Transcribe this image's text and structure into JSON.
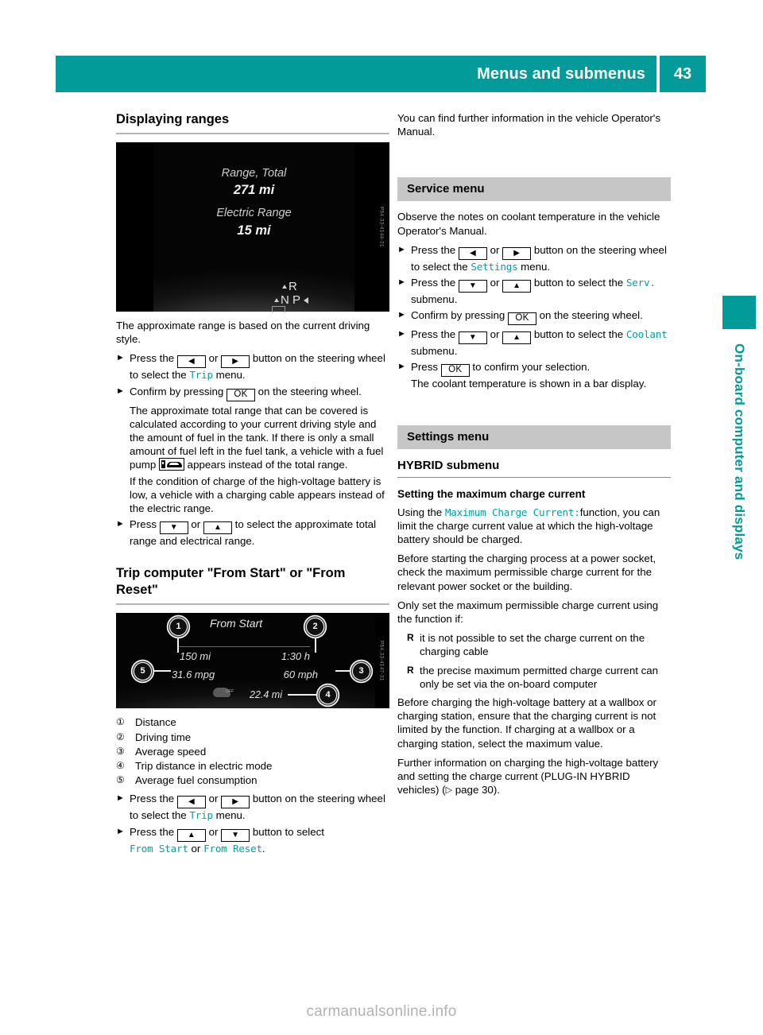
{
  "header": {
    "title": "Menus and submenus",
    "page_number": "43"
  },
  "side_tab": {
    "label": "On-board computer and displays"
  },
  "footer": {
    "watermark": "carmanualsonline.info"
  },
  "left_column": {
    "section_title": "Displaying ranges",
    "figure_range": {
      "label_total": "Range, Total",
      "value_total": "271 mi",
      "label_electric": "Electric Range",
      "value_electric": "15 mi",
      "gear_r": "R",
      "gear_n": "N",
      "gear_p": "P",
      "code": "P54.33-4144-31"
    },
    "intro": "The approximate range is based on the current driving style.",
    "step1_a": "Press the",
    "step1_or": "or",
    "step1_b": "button on the steering",
    "step1_c": "wheel to select the",
    "step1_menu": "Trip",
    "step1_d": "menu.",
    "step2_a": "Confirm by pressing",
    "step2_ok": "OK",
    "step2_b": "on the steering",
    "step2_c": "wheel.",
    "step2_note1": "The approximate total range that can be covered is calculated according to your current driving style and the amount of fuel in the tank. If there is only a small amount of fuel left in the fuel tank, a vehicle with a fuel pump",
    "step2_note1_end": "appears instead of the total range.",
    "step2_note2": "If the condition of charge of the high-voltage battery is low, a vehicle with a charging cable appears instead of the electric range.",
    "step3_a": "Press",
    "step3_or": "or",
    "step3_b": "to select the approximate total range and electrical range.",
    "trip_title": "Trip computer \"From Start\" or \"From Reset\"",
    "figure_trip": {
      "title": "From Start",
      "value_1": "150 mi",
      "value_2": "1:30 h",
      "value_5": "31.6 mpg",
      "value_3": "60 mph",
      "value_4": "22.4 mi",
      "callout_1": "1",
      "callout_2": "2",
      "callout_3": "3",
      "callout_4": "4",
      "callout_5": "5",
      "code": "P54.33-4147-31"
    },
    "legend": [
      {
        "num": "①",
        "text": "Distance"
      },
      {
        "num": "②",
        "text": "Driving time"
      },
      {
        "num": "③",
        "text": "Average speed"
      },
      {
        "num": "④",
        "text": "Trip distance in electric mode"
      },
      {
        "num": "⑤",
        "text": "Average fuel consumption"
      }
    ],
    "step4_a": "Press the",
    "step4_or": "or",
    "step4_b": "button on the steering",
    "step4_c": "wheel to select the",
    "step4_menu": "Trip",
    "step4_d": "menu.",
    "step5_a": "Press the",
    "step5_or": "or",
    "step5_b": "button to select",
    "step5_opt1": "From Start",
    "step5_mid": "or",
    "step5_opt2": "From Reset",
    "step5_end": "."
  },
  "right_column": {
    "intro": "You can find further information in the vehicle Operator's Manual.",
    "service_heading": "Service menu",
    "service_intro": "Observe the notes on coolant temperature in the vehicle Operator's Manual.",
    "s1_a": "Press the",
    "s1_or": "or",
    "s1_b": "button on the steering",
    "s1_c": "wheel to select the",
    "s1_menu": "Settings",
    "s1_d": "menu.",
    "s2_a": "Press the",
    "s2_or": "or",
    "s2_b": "button to select the",
    "s2_menu": "Serv.",
    "s2_c": "submenu.",
    "s3_a": "Confirm by pressing",
    "s3_ok": "OK",
    "s3_b": "on the steering",
    "s3_c": "wheel.",
    "s4_a": "Press the",
    "s4_or": "or",
    "s4_b": "button to select the",
    "s4_menu": "Coolant",
    "s4_c": "submenu.",
    "s5_a": "Press",
    "s5_ok": "OK",
    "s5_b": "to confirm your selection.",
    "s5_note": "The coolant temperature is shown in a bar display.",
    "settings_heading": "Settings menu",
    "hybrid_heading": "HYBRID submenu",
    "charge_heading": "Setting the maximum charge current",
    "charge_p1_a": "Using the",
    "charge_p1_mono": "Maximum Charge Current:",
    "charge_p1_b": "function, you can limit the charge current value at which the high-voltage battery should be charged.",
    "charge_p2": "Before starting the charging process at a power socket, check the maximum permissible charge current for the relevant power socket or the building.",
    "charge_p3": "Only set the maximum permissible charge current using the function if:",
    "bullets": [
      "it is not possible to set the charge current on the charging cable",
      "the precise maximum permitted charge current can only be set via the on-board computer"
    ],
    "charge_p4": "Before charging the high-voltage battery at a wallbox or charging station, ensure that the charging current is not limited by the function. If charging at a wallbox or a charging station, select the maximum value.",
    "charge_p5_a": "Further information on charging the high-voltage battery and setting the charge current (PLUG-IN HYBRID vehicles) (",
    "charge_p5_ref": "page 30",
    "charge_p5_b": ")."
  },
  "colors": {
    "teal": "#039a9a",
    "mono_teal": "#00a0a8",
    "gray_head_bg": "#c6c6c6"
  }
}
